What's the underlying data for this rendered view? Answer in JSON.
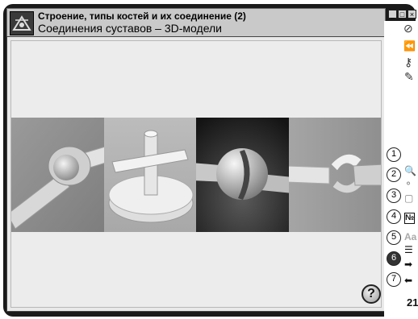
{
  "window": {
    "title_line1": "Строение, типы костей и их соединение (2)",
    "title_line2": "Соединения суставов – 3D-модели",
    "minimize_glyph": "_",
    "maximize_glyph": "□",
    "close_glyph": "×"
  },
  "help": {
    "label": "?"
  },
  "toolbar": {
    "icons": [
      "compass-icon",
      "rewind-icon",
      "key-icon",
      "pencil-icon"
    ]
  },
  "steps": [
    "1",
    "2",
    "3",
    "4",
    "5",
    "6",
    "7"
  ],
  "active_step": "6",
  "side_icons": {
    "zoom": "🔍",
    "molecule": "⚬",
    "cube": "▢",
    "number_sign": "№",
    "font_size": "Aa",
    "list": "☰",
    "arrow_right": "➡",
    "arrow_left": "⬅"
  },
  "page_number": "21",
  "colors": {
    "frame": "#1a1a1a",
    "titlebar": "#c9c9c9",
    "panel_dark": "#222222"
  }
}
